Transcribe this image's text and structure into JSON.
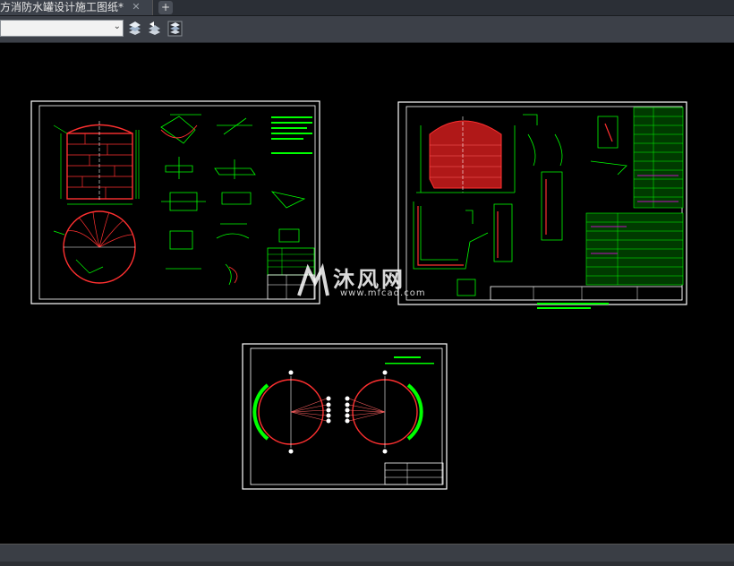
{
  "tabs": {
    "active_label": "方消防水罐设计施工图纸*",
    "close_glyph": "✕",
    "new_tab_glyph": "+"
  },
  "toolbar": {
    "layer_combo_value": "",
    "buttons": [
      "layer-match-icon",
      "layer-previous-icon",
      "layer-states-icon"
    ]
  },
  "watermark": {
    "title": "沐风网",
    "url": "www.mfcad.com"
  },
  "colors": {
    "accent_green": "#00ff00",
    "accent_red": "#ff0000",
    "frame_white": "#ffffff",
    "magenta": "#ff00ff"
  }
}
